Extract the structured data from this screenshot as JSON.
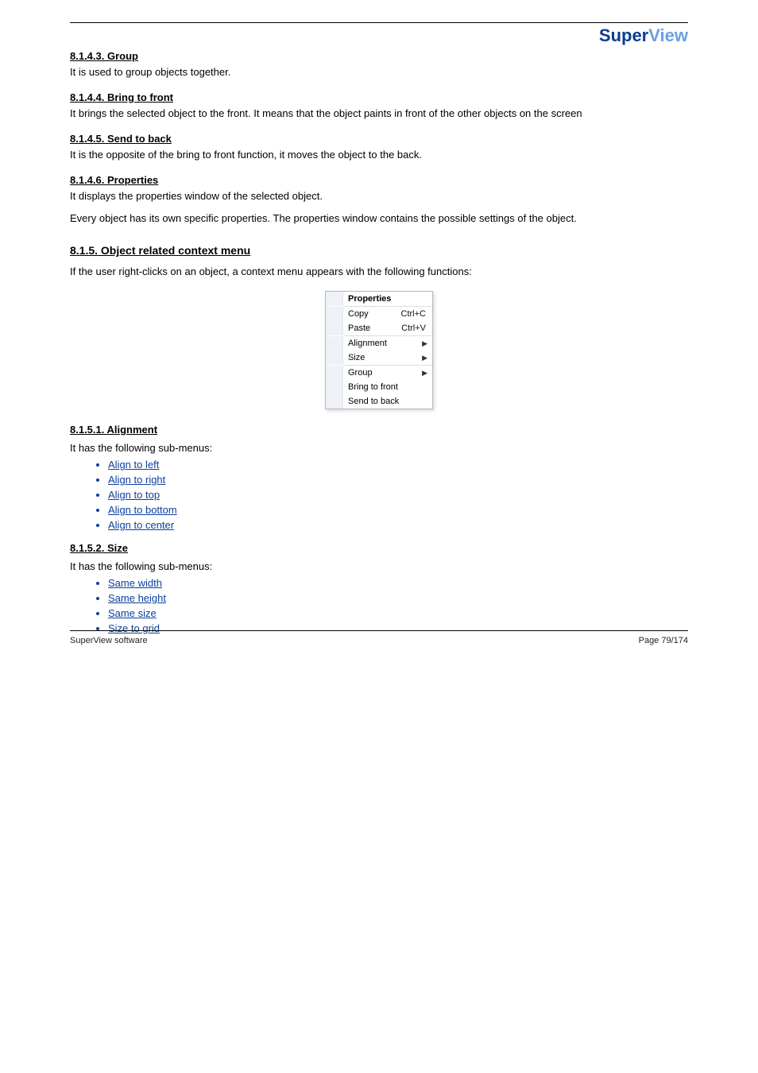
{
  "logo": {
    "part1": "Super",
    "part2": "View"
  },
  "sections": {
    "s1": {
      "heading": "8.1.4.3. Group",
      "para": "It is used to group objects together."
    },
    "s2": {
      "heading": "8.1.4.4. Bring to front",
      "para": "It brings the selected object to the front. It means that the object paints in front of the other objects on the screen"
    },
    "s3": {
      "heading": "8.1.4.5. Send to back",
      "para": "It is the opposite of the bring to front function, it moves the object to the back."
    },
    "s4": {
      "heading": "8.1.4.6. Properties",
      "para1": "It displays the properties window of the selected object.",
      "para2": "Every object has its own specific properties. The properties window contains the possible settings of the object."
    }
  },
  "bigSection": {
    "heading": "8.1.5. Object related context menu",
    "para": "If the user right-clicks on an object, a context menu appears with the following functions:"
  },
  "contextMenu": {
    "items": [
      {
        "label": "Properties",
        "bold": true
      },
      {
        "label": "Copy",
        "shortcut": "Ctrl+C"
      },
      {
        "label": "Paste",
        "shortcut": "Ctrl+V"
      },
      {
        "label": "Alignment",
        "submenu": true
      },
      {
        "label": "Size",
        "submenu": true
      },
      {
        "label": "Group",
        "submenu": true
      },
      {
        "label": "Bring to front"
      },
      {
        "label": "Send to back"
      }
    ]
  },
  "functionList": {
    "alignment": {
      "title": "8.1.5.1. Alignment",
      "intro": "It has the following sub-menus:",
      "items": [
        "Align to left",
        "Align to right",
        "Align to top",
        "Align to bottom",
        "Align to center"
      ]
    },
    "size": {
      "title": "8.1.5.2. Size",
      "intro": "It has the following sub-menus:",
      "items": [
        "Same width",
        "Same height",
        "Same size",
        "Size to grid"
      ]
    }
  },
  "footer": {
    "left": "SuperView software",
    "right": "Page 79/174"
  }
}
